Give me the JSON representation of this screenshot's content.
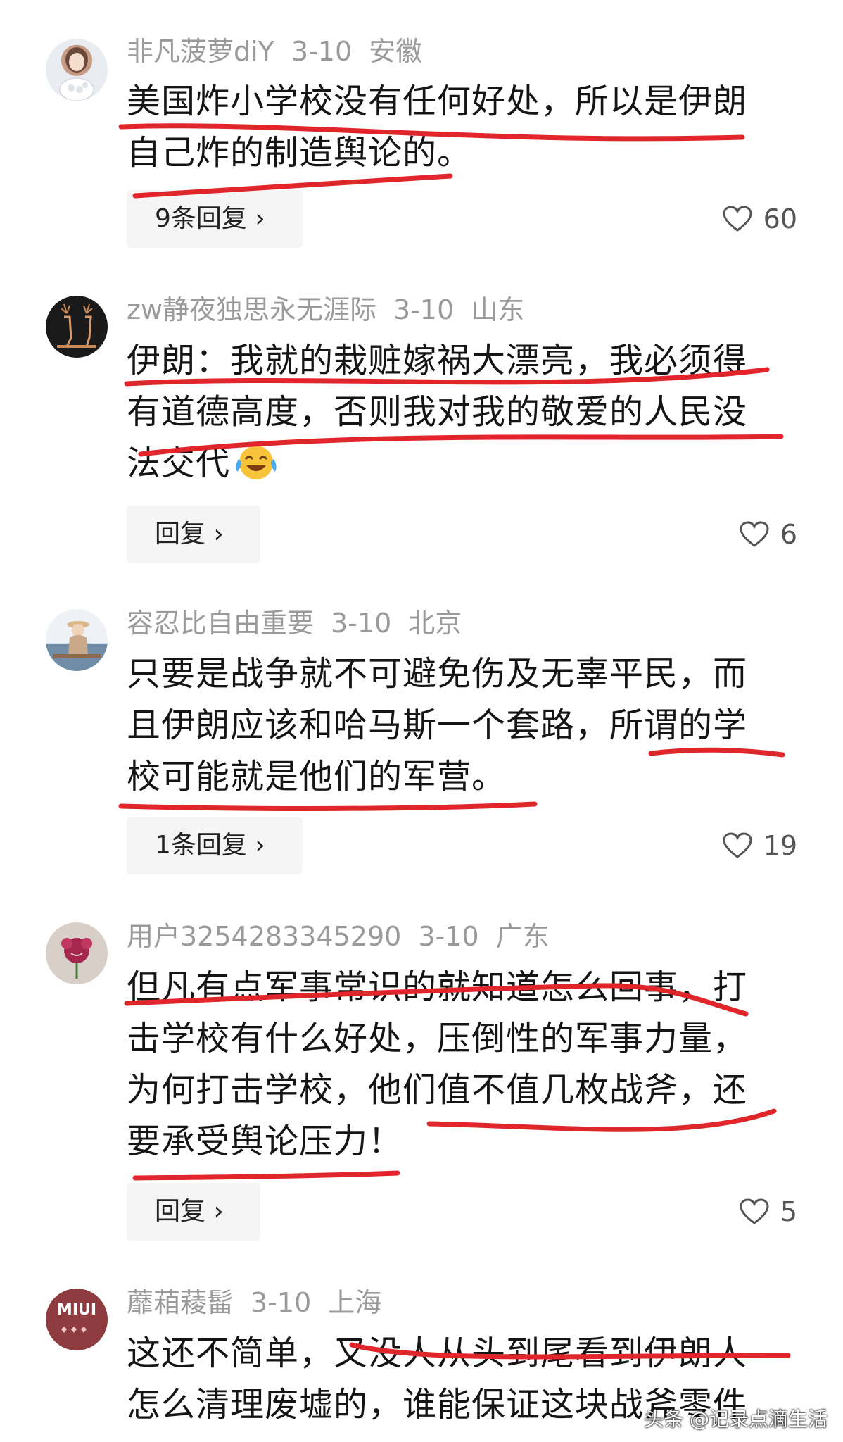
{
  "comments": [
    {
      "username": "非凡菠萝diY",
      "date": "3-10",
      "location": "安徽",
      "lines": [
        "美国炸小学校没有任何好处，所以是伊朗",
        "自己炸的制造舆论的。"
      ],
      "reply_label": "9条回复 ›",
      "likes": "60"
    },
    {
      "username": "zw静夜独思永无涯际",
      "date": "3-10",
      "location": "山东",
      "lines": [
        "伊朗：我就的栽赃嫁祸大漂亮，我必须得",
        "有道德高度，否则我对我的敬爱的人民没",
        "法交代"
      ],
      "emoji": "laughing-crying",
      "reply_label": "回复 ›",
      "likes": "6"
    },
    {
      "username": "容忍比自由重要",
      "date": "3-10",
      "location": "北京",
      "lines": [
        "只要是战争就不可避免伤及无辜平民，而",
        "且伊朗应该和哈马斯一个套路，所谓的学",
        "校可能就是他们的军营。"
      ],
      "reply_label": "1条回复 ›",
      "likes": "19"
    },
    {
      "username": "用户3254283345290",
      "date": "3-10",
      "location": "广东",
      "lines": [
        "但凡有点军事常识的就知道怎么回事，打",
        "击学校有什么好处，压倒性的军事力量，",
        "为何打击学校，他们值不值几枚战斧，还",
        "要承受舆论压力！"
      ],
      "reply_label": "回复 ›",
      "likes": "5"
    },
    {
      "username": "蘼葙薐髷",
      "date": "3-10",
      "location": "上海",
      "lines": [
        "这还不简单，又没人从头到尾看到伊朗人",
        "怎么清理废墟的，谁能保证这块战斧零件"
      ],
      "avatar_text": "MIUI",
      "reply_label": "",
      "likes": ""
    }
  ],
  "watermark": "头条 @记录点滴生活",
  "colors": {
    "underline": "#e0262b",
    "meta": "#9a9a9a",
    "text": "#151515"
  }
}
